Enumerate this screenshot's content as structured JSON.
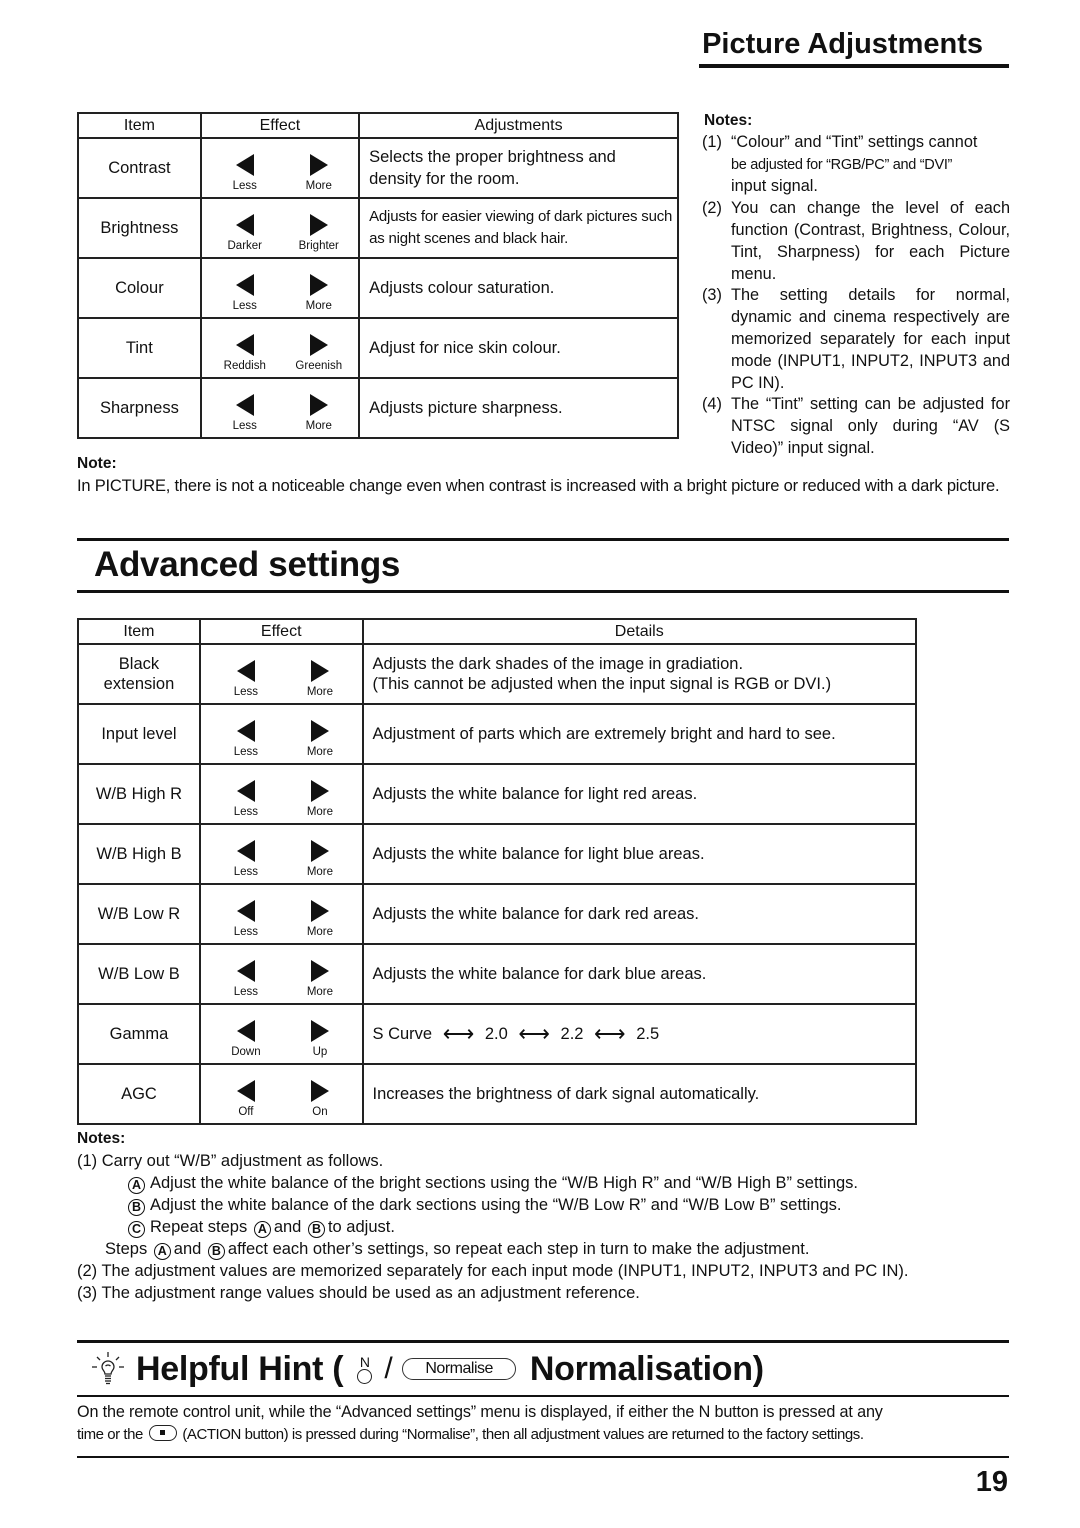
{
  "header": {
    "title": "Picture Adjustments"
  },
  "picture_table": {
    "columns": [
      "Item",
      "Effect",
      "Adjustments"
    ],
    "rows": [
      {
        "item": "Contrast",
        "left_label": "Less",
        "right_label": "More",
        "description": "Selects the proper brightness and density for the room."
      },
      {
        "item": "Brightness",
        "left_label": "Darker",
        "right_label": "Brighter",
        "description": "Adjusts for easier viewing of dark pictures such as night scenes and black hair."
      },
      {
        "item": "Colour",
        "left_label": "Less",
        "right_label": "More",
        "description": "Adjusts colour saturation."
      },
      {
        "item": "Tint",
        "left_label": "Reddish",
        "right_label": "Greenish",
        "description": "Adjust for nice skin colour."
      },
      {
        "item": "Sharpness",
        "left_label": "Less",
        "right_label": "More",
        "description": "Adjusts picture sharpness."
      }
    ]
  },
  "picture_notes": {
    "heading": "Notes:",
    "items": [
      {
        "num": "(1)",
        "text": "“Colour” and “Tint” settings cannot",
        "text_cont": "be adjusted for “RGB/PC” and “DVI”",
        "text_end": "input signal."
      },
      {
        "num": "(2)",
        "text": "You can change the level of each function (Contrast, Brightness, Colour, Tint, Sharpness) for each Picture menu."
      },
      {
        "num": "(3)",
        "text": "The setting details for normal, dynamic and cinema respectively are memorized separately for each input mode (INPUT1, INPUT2, INPUT3 and PC IN)."
      },
      {
        "num": "(4)",
        "text": "The “Tint” setting can be adjusted for NTSC signal only during “AV (S Video)” input signal."
      }
    ]
  },
  "picture_note": {
    "heading": "Note:",
    "text": "In PICTURE, there is not a noticeable change even when contrast is increased with a bright picture or reduced with a dark picture."
  },
  "advanced": {
    "title": "Advanced settings",
    "columns": [
      "Item",
      "Effect",
      "Details"
    ],
    "rows": [
      {
        "item": "Black extension",
        "left_label": "Less",
        "right_label": "More",
        "description": "Adjusts the dark shades of the image in gradiation.",
        "description2": "(This cannot be adjusted when the input signal is RGB or DVI.)"
      },
      {
        "item": "Input level",
        "left_label": "Less",
        "right_label": "More",
        "description": "Adjustment of parts which are extremely bright and hard to see."
      },
      {
        "item": "W/B High R",
        "left_label": "Less",
        "right_label": "More",
        "description": "Adjusts the white balance for light red areas."
      },
      {
        "item": "W/B High B",
        "left_label": "Less",
        "right_label": "More",
        "description": "Adjusts the white balance for light blue areas."
      },
      {
        "item": "W/B Low R",
        "left_label": "Less",
        "right_label": "More",
        "description": "Adjusts the white balance for dark red areas."
      },
      {
        "item": "W/B Low B",
        "left_label": "Less",
        "right_label": "More",
        "description": "Adjusts the white balance for dark blue areas."
      },
      {
        "item": "Gamma",
        "left_label": "Down",
        "right_label": "Up",
        "gamma_values": [
          "S Curve",
          "2.0",
          "2.2",
          "2.5"
        ],
        "gamma_separator": "⟷"
      },
      {
        "item": "AGC",
        "left_label": "Off",
        "right_label": "On",
        "description": "Increases the brightness of dark signal automatically."
      }
    ]
  },
  "advanced_notes": {
    "heading": "Notes:",
    "n1": "(1) Carry out “W/B” adjustment as follows.",
    "stepA_mark": "A",
    "stepA": "Adjust the white balance of the bright sections using the “W/B High R” and “W/B High B” settings.",
    "stepB_mark": "B",
    "stepB": "Adjust the white balance of the dark sections using the “W/B Low R” and “W/B Low B” settings.",
    "stepC_mark": "C",
    "stepC_pre": "Repeat steps",
    "stepC_and": "and",
    "stepC_post": "to adjust.",
    "steps_pre": "Steps",
    "steps_and": "and",
    "steps_post": "affect each other’s settings, so repeat each step in turn to make the adjustment.",
    "n2": "(2) The adjustment values are memorized separately for each input mode (INPUT1, INPUT2, INPUT3 and PC IN).",
    "n3": "(3) The adjustment range values should be used as an adjustment reference."
  },
  "hint": {
    "title_pre": "Helpful Hint (",
    "n_label": "N",
    "slash": "/",
    "pill_label": "Normalise",
    "title_post": "Normalisation)",
    "line1": "On the remote control unit, while the “Advanced settings” menu is displayed, if either the N button is pressed at any",
    "line2_pre": "time or the",
    "line2_post": "(ACTION button) is pressed during “Normalise”, then all adjustment values are returned to the factory settings."
  },
  "page_number": "19"
}
